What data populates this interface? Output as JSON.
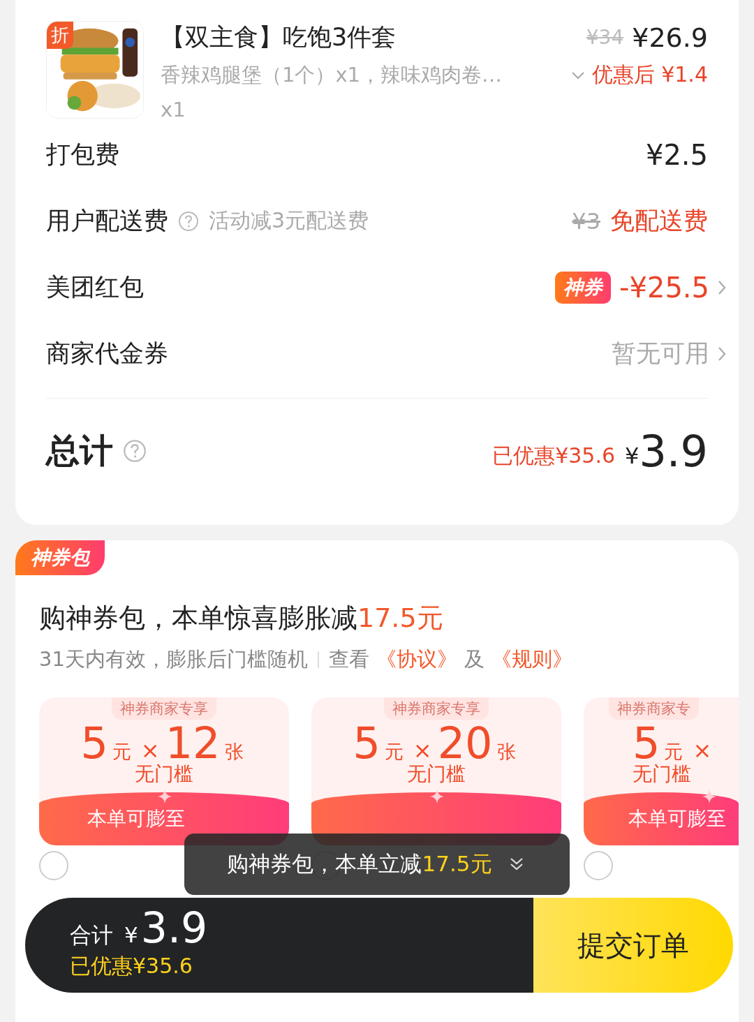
{
  "item": {
    "badge": "折",
    "name": "【双主食】吃饱3件套",
    "description": "香辣鸡腿堡（1个）x1，辣味鸡肉卷…",
    "quantity": "x1",
    "original_price": "¥34",
    "price": "¥26.9",
    "discount_label": "优惠后 ¥1.4"
  },
  "fees": [
    {
      "kind": "plain",
      "label": "打包费",
      "value": "¥2.5"
    },
    {
      "kind": "delivery",
      "label": "用户配送费",
      "note": "活动减3元配送费",
      "original": "¥3",
      "value": "免配送费"
    },
    {
      "kind": "coupon",
      "label": "美团红包",
      "tag": "神券",
      "value": "-¥25.5"
    },
    {
      "kind": "muted",
      "label": "商家代金券",
      "value": "暂无可用"
    }
  ],
  "total": {
    "label": "总计",
    "saved": "已优惠¥35.6",
    "currency": "¥",
    "amount": "3.9"
  },
  "pack": {
    "badge": "神券包",
    "headline": "购神券包，本单惊喜膨胀减",
    "highlight": "17.5元",
    "validity": "31天内有效，膨胀后门槛随机",
    "view": "查看",
    "agreement": "《协议》",
    "and": "及",
    "rules": "《规则》",
    "cards": [
      {
        "tag": "神券商家专享",
        "amount": "5",
        "unit": "元",
        "times": "×",
        "count": "12",
        "count_unit": "张",
        "threshold": "无门槛",
        "footer": "本单可膨至",
        "selected": false
      },
      {
        "tag": "神券商家专享",
        "amount": "5",
        "unit": "元",
        "times": "×",
        "count": "20",
        "count_unit": "张",
        "threshold": "无门槛",
        "selected": false
      },
      {
        "tag": "神券商家专",
        "amount": "5",
        "unit": "元",
        "times": "×",
        "threshold": "无门槛",
        "footer": "本单可膨至",
        "selected": false
      }
    ]
  },
  "toast": {
    "text": "购神券包，本单立减",
    "highlight": "17.5元"
  },
  "bottom_bar": {
    "label": "合计",
    "currency": "¥",
    "amount": "3.9",
    "saved": "已优惠¥35.6",
    "submit": "提交订单"
  }
}
